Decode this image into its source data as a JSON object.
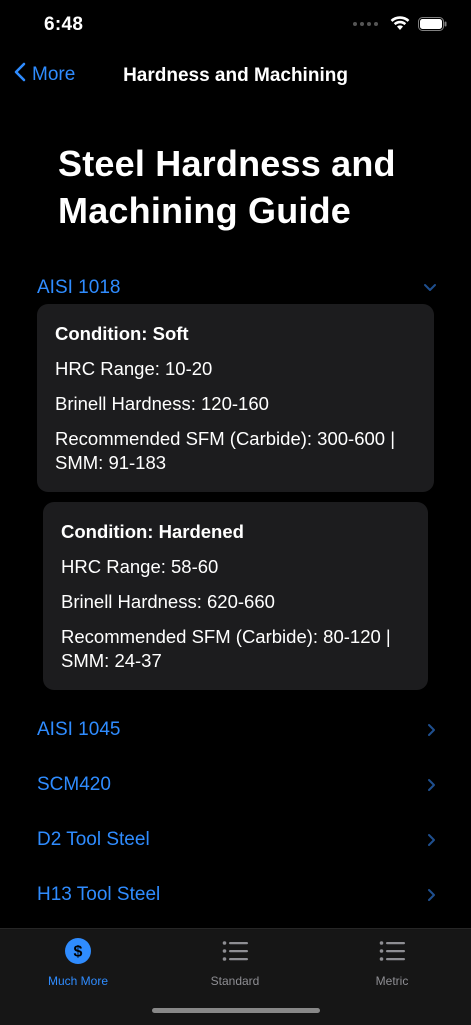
{
  "status": {
    "time": "6:48"
  },
  "nav": {
    "back_label": "More",
    "title": "Hardness and Machining"
  },
  "page": {
    "title": "Steel Hardness and Machining Guide"
  },
  "colors": {
    "accent": "#2f8cff",
    "card": "#1c1c1e",
    "background": "#000000",
    "inactive_tab": "#8e8e93"
  },
  "sections": [
    {
      "label": "AISI 1018",
      "expanded": true,
      "conditions": [
        {
          "heading": "Condition: Soft",
          "hrc": "HRC Range: 10-20",
          "brinell": "Brinell Hardness: 120-160",
          "sfm_line1": "Recommended SFM (Carbide): 300-600 |",
          "sfm_line2": "SMM: 91-183"
        },
        {
          "heading": "Condition: Hardened",
          "hrc": "HRC Range: 58-60",
          "brinell": "Brinell Hardness: 620-660",
          "sfm_line1": "Recommended SFM (Carbide): 80-120 |",
          "sfm_line2": "SMM: 24-37"
        }
      ]
    },
    {
      "label": "AISI 1045",
      "expanded": false
    },
    {
      "label": "SCM420",
      "expanded": false
    },
    {
      "label": "D2 Tool Steel",
      "expanded": false
    },
    {
      "label": "H13 Tool Steel",
      "expanded": false
    }
  ],
  "tabs": [
    {
      "label": "Much More",
      "icon": "dollar-circle-icon",
      "active": true
    },
    {
      "label": "Standard",
      "icon": "list-icon",
      "active": false
    },
    {
      "label": "Metric",
      "icon": "list-icon",
      "active": false
    }
  ]
}
